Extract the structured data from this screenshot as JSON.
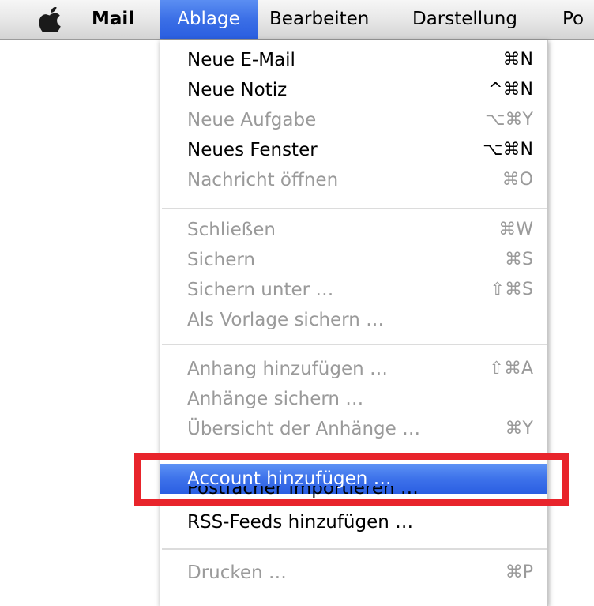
{
  "menubar": {
    "apple_icon": "apple-logo-icon",
    "items": [
      {
        "label": "Mail"
      },
      {
        "label": "Ablage"
      },
      {
        "label": "Bearbeiten"
      },
      {
        "label": "Darstellung"
      },
      {
        "label": "Po"
      }
    ],
    "active_item": "Ablage"
  },
  "menu": {
    "items": [
      {
        "label": "Neue E-Mail",
        "shortcut": "⌘N",
        "enabled": true
      },
      {
        "label": "Neue Notiz",
        "shortcut": "^⌘N",
        "enabled": true
      },
      {
        "label": "Neue Aufgabe",
        "shortcut": "⌥⌘Y",
        "enabled": false
      },
      {
        "label": "Neues Fenster",
        "shortcut": "⌥⌘N",
        "enabled": true
      },
      {
        "label": "Nachricht öffnen",
        "shortcut": "⌘O",
        "enabled": false
      },
      {
        "label": "Schließen",
        "shortcut": "⌘W",
        "enabled": false
      },
      {
        "label": "Sichern",
        "shortcut": "⌘S",
        "enabled": false
      },
      {
        "label": "Sichern unter …",
        "shortcut": "⇧⌘S",
        "enabled": false
      },
      {
        "label": "Als Vorlage sichern …",
        "shortcut": "",
        "enabled": false
      },
      {
        "label": "Anhang hinzufügen …",
        "shortcut": "⇧⌘A",
        "enabled": false
      },
      {
        "label": "Anhänge sichern …",
        "shortcut": "",
        "enabled": false
      },
      {
        "label": "Übersicht der Anhänge …",
        "shortcut": "⌘Y",
        "enabled": false
      },
      {
        "label": "Account hinzufügen …",
        "shortcut": "",
        "enabled": true,
        "highlighted": true
      },
      {
        "label": "Postfächer importieren …",
        "shortcut": "",
        "enabled": true,
        "partially_obscured": true
      },
      {
        "label": "RSS-Feeds hinzufügen …",
        "shortcut": "",
        "enabled": true
      },
      {
        "label": "Drucken …",
        "shortcut": "⌘P",
        "enabled": false
      }
    ]
  },
  "colors": {
    "highlight": "#3d72ea",
    "annotation": "#e8242b",
    "disabled_text": "#9a9a9a"
  }
}
